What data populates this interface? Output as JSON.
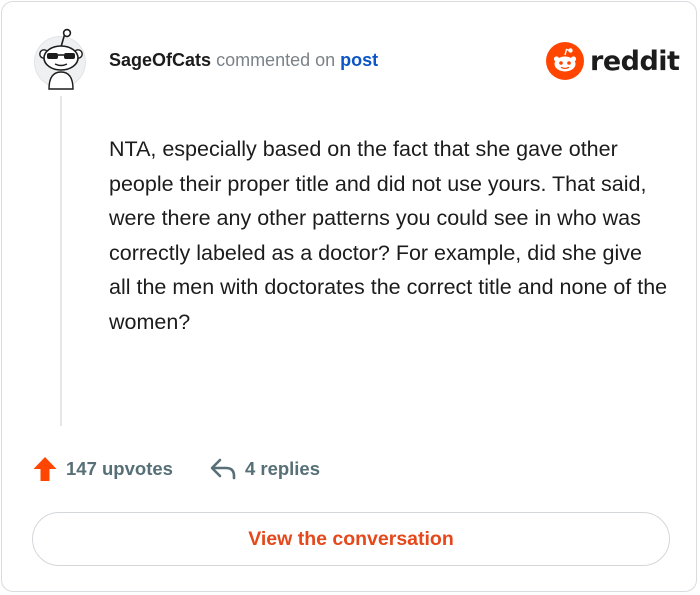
{
  "header": {
    "username": "SageOfCats",
    "action_text": "commented on",
    "post_link": "post"
  },
  "brand": {
    "wordmark": "reddit",
    "logo_icon": "reddit-snoo-icon",
    "accent_color": "#ff4500"
  },
  "comment": {
    "body": "NTA, especially based on the fact that she gave other people their proper title and did not use yours. That said, were there any other patterns you could see in who was correctly labeled as a doctor? For example, did she give all the men with doctorates the correct title and none of the women?"
  },
  "stats": {
    "upvotes": "147 upvotes",
    "replies": "4 replies",
    "upvote_icon": "upvote-arrow-icon",
    "reply_icon": "reply-arrow-icon"
  },
  "cta": {
    "label": "View the conversation",
    "color": "#e5481b"
  }
}
